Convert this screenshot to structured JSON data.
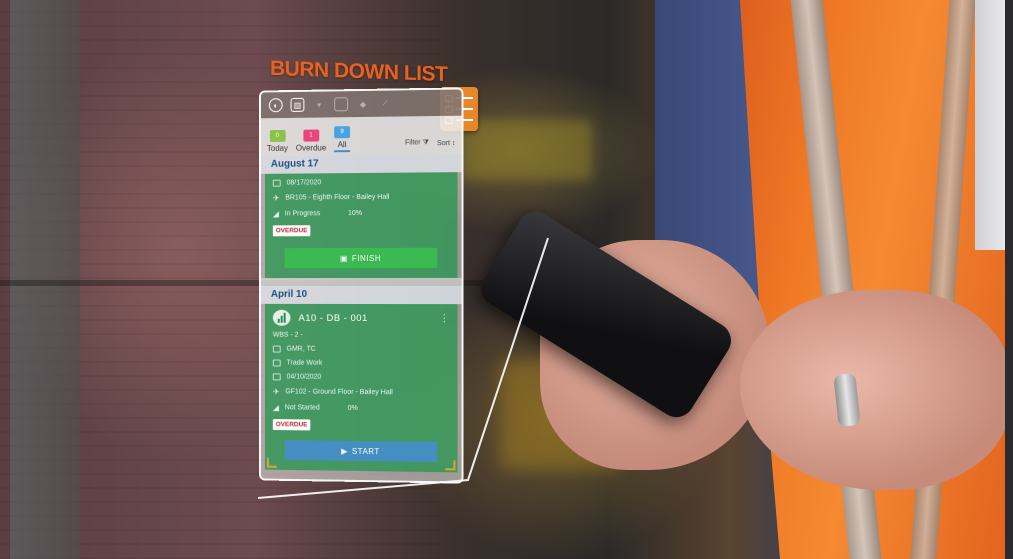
{
  "overlay": {
    "title": "BURN DOWN LIST"
  },
  "app": {
    "tabs": [
      {
        "label": "Today",
        "count": "0",
        "color": "#8bc34a"
      },
      {
        "label": "Overdue",
        "count": "1",
        "color": "#e8457a"
      },
      {
        "label": "All",
        "count": "9",
        "color": "#4aa3e0"
      }
    ],
    "filter_label": "Filter",
    "sort_label": "Sort",
    "groups": [
      {
        "date": "August 17",
        "date_value": "08/17/2020",
        "location": "BR105 - Eighth Floor - Bailey Hall",
        "status": "In Progress",
        "percent": "10%",
        "badge": "OVERDUE",
        "action": "FINISH"
      },
      {
        "date": "April 10",
        "task_name": "A10 - DB - 001",
        "wbs": "WBS - 2 -",
        "crew": "GMR, TC",
        "trade": "Trade Work",
        "date_value": "04/10/2020",
        "location": "GF102 - Ground Floor - Bailey Hall",
        "status": "Not Started",
        "percent": "0%",
        "badge": "OVERDUE",
        "action": "START"
      }
    ]
  }
}
